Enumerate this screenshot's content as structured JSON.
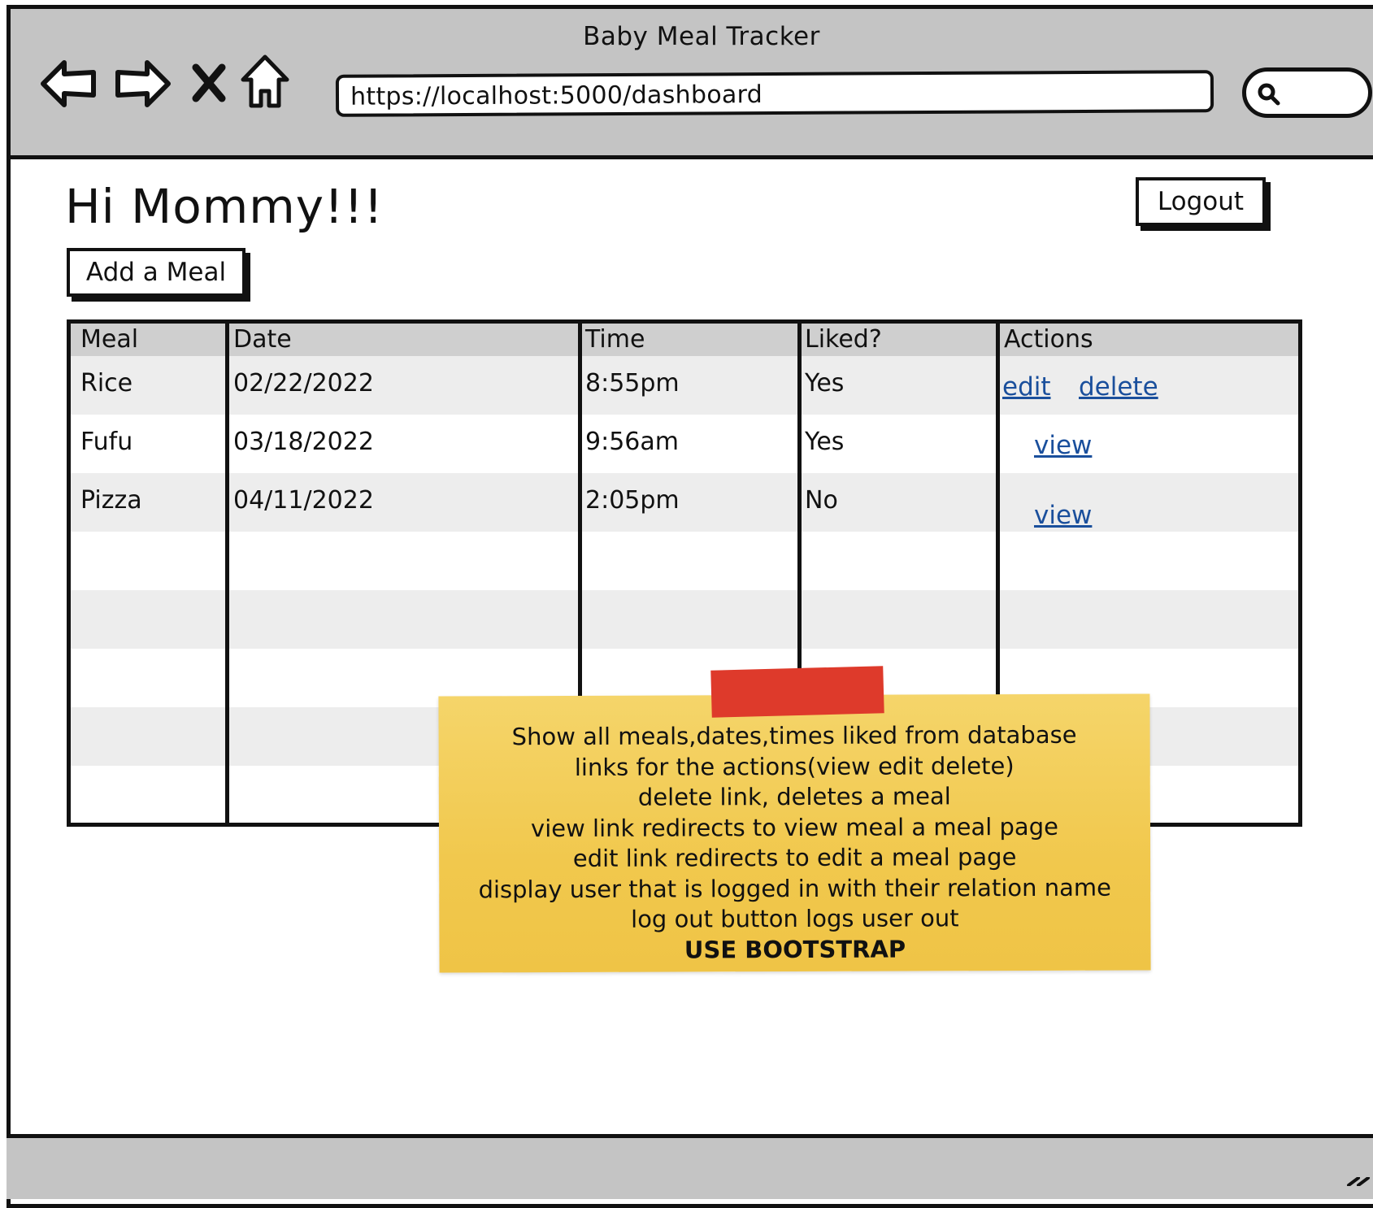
{
  "browser": {
    "title": "Baby Meal Tracker",
    "url": "https://localhost:5000/dashboard"
  },
  "page": {
    "greeting": "Hi Mommy!!!",
    "logout_label": "Logout",
    "add_meal_label": "Add a Meal"
  },
  "table": {
    "headers": [
      "Meal",
      "Date",
      "Time",
      "Liked?",
      "Actions"
    ],
    "rows": [
      {
        "meal": "Rice",
        "date": "02/22/2022",
        "time": "8:55pm",
        "liked": "Yes",
        "actions": [
          "edit",
          "delete"
        ]
      },
      {
        "meal": "Fufu",
        "date": "03/18/2022",
        "time": "9:56am",
        "liked": "Yes",
        "actions": [
          "view"
        ]
      },
      {
        "meal": "Pizza",
        "date": "04/11/2022",
        "time": "2:05pm",
        "liked": "No",
        "actions": [
          "view"
        ]
      }
    ]
  },
  "note": {
    "lines": [
      "Show all meals,dates,times liked from database",
      "links for the actions(view edit delete)",
      "delete link, deletes a meal",
      "view link redirects to view meal a meal page",
      "edit link redirects to edit a meal page",
      "display user that is logged in with their relation name",
      "log out button logs user out",
      "USE BOOTSTRAP"
    ]
  },
  "colors": {
    "chrome": "#c4c4c4",
    "link": "#1a4f9c",
    "note": "#f1c84d",
    "tape": "#de3a2b"
  },
  "icons": [
    "back-arrow-icon",
    "forward-arrow-icon",
    "stop-icon",
    "home-icon",
    "search-icon",
    "resize-grip-icon"
  ]
}
